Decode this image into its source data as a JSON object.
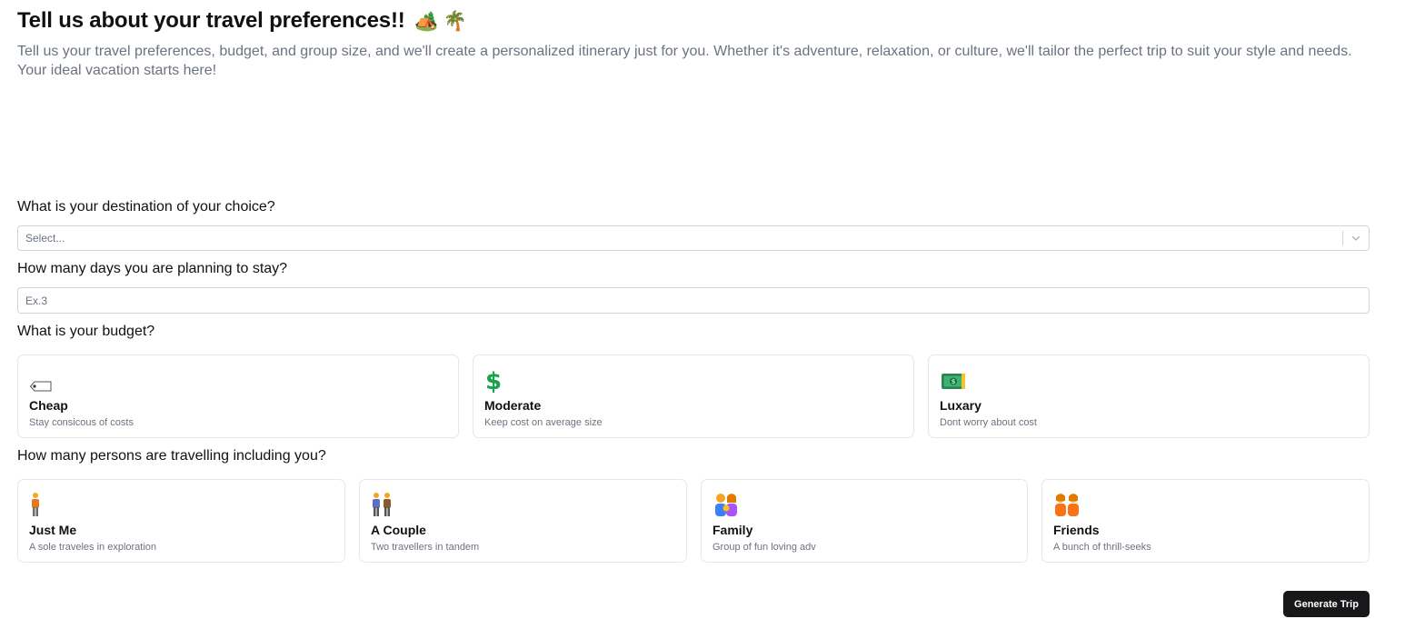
{
  "header": {
    "title": "Tell us about your travel preferences!!",
    "title_emoji": "🏕️ 🌴",
    "subtitle": "Tell us your travel preferences, budget, and group size, and we'll create a personalized itinerary just for you. Whether it's adventure, relaxation, or culture, we'll tailor the perfect trip to suit your style and needs. Your ideal vacation starts here!"
  },
  "destination": {
    "question": "What is your destination of your choice?",
    "placeholder": "Select..."
  },
  "days": {
    "question": "How many days you are planning to stay?",
    "placeholder": "Ex.3"
  },
  "budget": {
    "question": "What is your budget?",
    "options": [
      {
        "icon": "price-tag-icon",
        "title": "Cheap",
        "desc": "Stay consicous of costs"
      },
      {
        "icon": "dollar-sign-icon",
        "title": "Moderate",
        "desc": "Keep cost on average size"
      },
      {
        "icon": "money-bill-icon",
        "title": "Luxary",
        "desc": "Dont worry about cost"
      }
    ]
  },
  "travellers": {
    "question": "How many persons are travelling including you?",
    "options": [
      {
        "icon": "person-icon",
        "title": "Just Me",
        "desc": "A sole traveles in exploration"
      },
      {
        "icon": "couple-icon",
        "title": "A Couple",
        "desc": "Two travellers in tandem"
      },
      {
        "icon": "family-icon",
        "title": "Family",
        "desc": "Group of fun loving adv"
      },
      {
        "icon": "friends-icon",
        "title": "Friends",
        "desc": "A bunch of thrill-seeks"
      }
    ]
  },
  "actions": {
    "generate_label": "Generate Trip"
  },
  "colors": {
    "accent_button": "#18181b",
    "muted_text": "#6b7280",
    "border": "#e5e7eb",
    "dollar_green": "#16a34a"
  }
}
